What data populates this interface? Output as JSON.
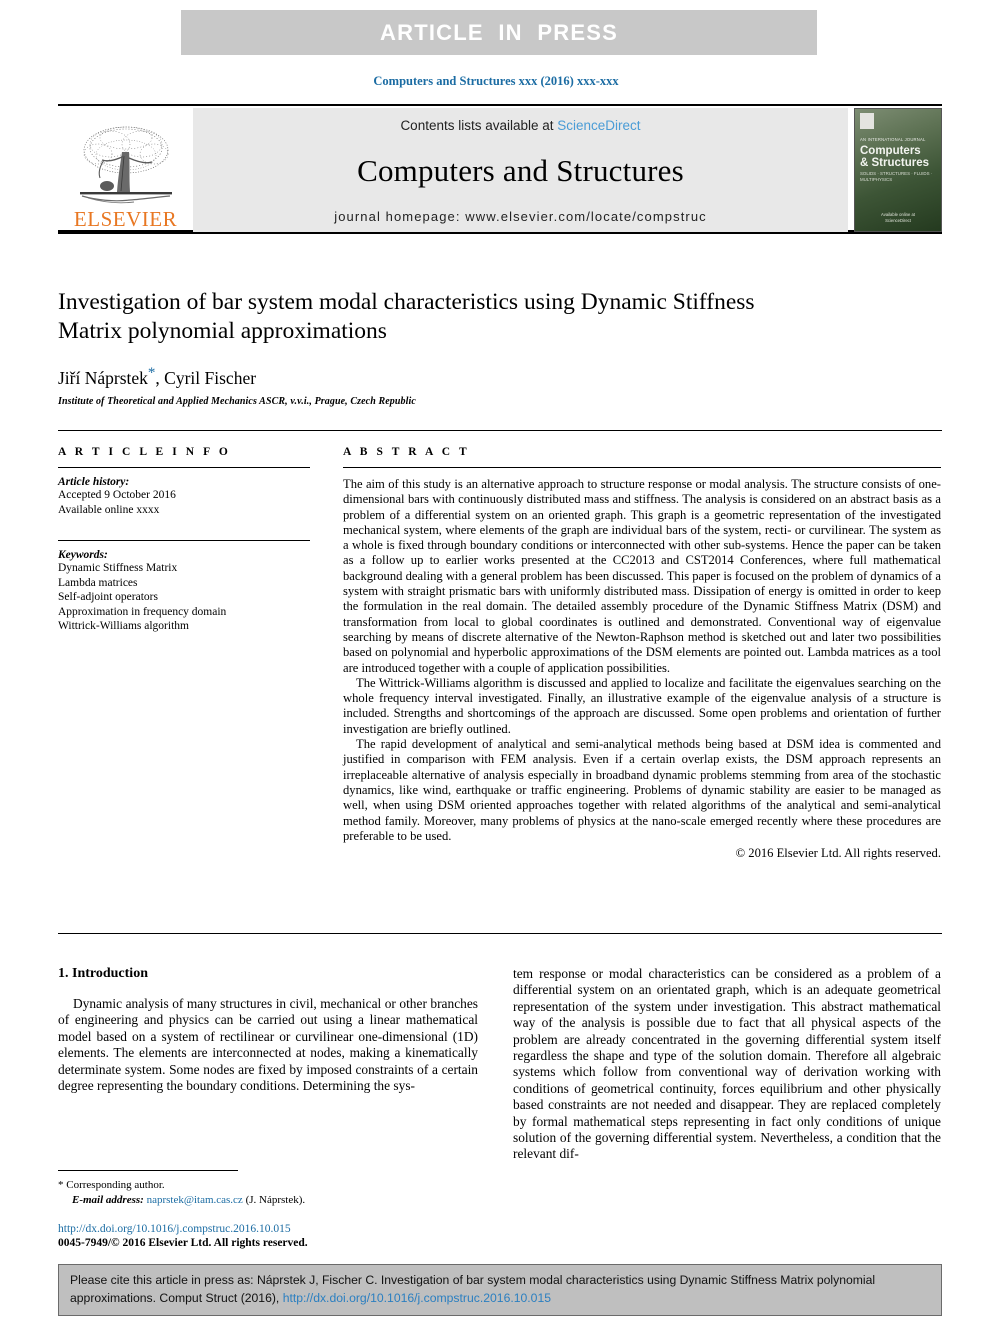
{
  "banner": {
    "text": "ARTICLE  IN  PRESS",
    "bg_color": "#C8C8C8",
    "text_color": "#FFFFFF"
  },
  "journal_ref": "Computers and Structures xxx (2016) xxx-xxx",
  "masthead": {
    "contents_prefix": "Contents lists available at ",
    "sciencedirect_link": "ScienceDirect",
    "journal_title": "Computers and Structures",
    "homepage": "journal homepage: www.elsevier.com/locate/compstruc",
    "publisher_wordmark": "ELSEVIER",
    "publisher_color": "#E87722",
    "link_color": "#4A9CD6",
    "panel_bg": "#E8E8E8",
    "cover": {
      "eyebrow": "AN INTERNATIONAL JOURNAL",
      "title_line1": "Computers",
      "title_line2": "& Structures",
      "subtitle": "SOLIDS · STRUCTURES · FLUIDS · MULTIPHYSICS",
      "footer_line1": "Available online at",
      "footer_line2": "ScienceDirect"
    }
  },
  "article": {
    "title": "Investigation of bar system modal characteristics using Dynamic Stiffness Matrix polynomial approximations",
    "authors": "Jiří Náprstek",
    "authors_rest": ", Cyril Fischer",
    "corresponding_marker": "*",
    "affiliation": "Institute of Theoretical and Applied Mechanics ASCR, v.v.i., Prague, Czech Republic"
  },
  "article_info": {
    "heading": "A R T I C L E    I N F O",
    "history_label": "Article history:",
    "history_lines": [
      "Accepted 9 October 2016",
      "Available online xxxx"
    ],
    "keywords_label": "Keywords:",
    "keywords": [
      "Dynamic Stiffness Matrix",
      "Lambda matrices",
      "Self-adjoint operators",
      "Approximation in frequency domain",
      "Wittrick-Williams algorithm"
    ]
  },
  "abstract": {
    "heading": "A B S T R A C T",
    "paragraphs": [
      "The aim of this study is an alternative approach to structure response or modal analysis. The structure consists of one-dimensional bars with continuously distributed mass and stiffness. The analysis is considered on an abstract basis as a problem of a differential system on an oriented graph. This graph is a geometric representation of the investigated mechanical system, where elements of the graph are individual bars of the system, recti- or curvilinear. The system as a whole is fixed through boundary conditions or interconnected with other sub-systems. Hence the paper can be taken as a follow up to earlier works presented at the CC2013 and CST2014 Conferences, where full mathematical background dealing with a general problem has been discussed. This paper is focused on the problem of dynamics of a system with straight prismatic bars with uniformly distributed mass. Dissipation of energy is omitted in order to keep the formulation in the real domain. The detailed assembly procedure of the Dynamic Stiffness Matrix (DSM) and transformation from local to global coordinates is outlined and demonstrated. Conventional way of eigenvalue searching by means of discrete alternative of the Newton-Raphson method is sketched out and later two possibilities based on polynomial and hyperbolic approximations of the DSM elements are pointed out. Lambda matrices as a tool are introduced together with a couple of application possibilities.",
      "The Wittrick-Williams algorithm is discussed and applied to localize and facilitate the eigenvalues searching on the whole frequency interval investigated. Finally, an illustrative example of the eigenvalue analysis of a structure is included. Strengths and shortcomings of the approach are discussed. Some open problems and orientation of further investigation are briefly outlined.",
      "The rapid development of analytical and semi-analytical methods being based at DSM idea is commented and justified in comparison with FEM analysis. Even if a certain overlap exists, the DSM approach represents an irreplaceable alternative of analysis especially in broadband dynamic problems stemming from area of the stochastic dynamics, like wind, earthquake or traffic engineering. Problems of dynamic stability are easier to be managed as well, when using DSM oriented approaches together with related algorithms of the analytical and semi-analytical method family. Moreover, many problems of physics at the nano-scale emerged recently where these procedures are preferable to be used."
    ],
    "copyright": "© 2016 Elsevier Ltd. All rights reserved."
  },
  "body": {
    "section_title": "1. Introduction",
    "left_paragraph": "Dynamic analysis of many structures in civil, mechanical or other branches of engineering and physics can be carried out using a linear mathematical model based on a system of rectilinear or curvilinear one-dimensional (1D) elements. The elements are interconnected at nodes, making a kinematically determinate system. Some nodes are fixed by imposed constraints of a certain degree representing the boundary conditions. Determining the sys-",
    "right_paragraph": "tem response or modal characteristics can be considered as a problem of a differential system on an orientated graph, which is an adequate geometrical representation of the system under investigation. This abstract mathematical way of the analysis is possible due to fact that all physical aspects of the problem are already concentrated in the governing differential system itself regardless the shape and type of the solution domain. Therefore all algebraic systems which follow from conventional way of derivation working with conditions of geometrical continuity, forces equilibrium and other physically based constraints are not needed and disappear. They are replaced completely by formal mathematical steps representing in fact only conditions of unique solution of the governing differential system. Nevertheless, a condition that the relevant dif-"
  },
  "footnote": {
    "marker": "*",
    "corresponding_author": "Corresponding author.",
    "email_label": "E-mail address:",
    "email": "naprstek@itam.cas.cz",
    "email_owner": "(J. Náprstek)."
  },
  "footer": {
    "doi_url": "http://dx.doi.org/10.1016/j.compstruc.2016.10.015",
    "issn_line": "0045-7949/© 2016 Elsevier Ltd. All rights reserved."
  },
  "cite_box": {
    "text_before": "Please cite this article in press as: Náprstek J, Fischer C. Investigation of bar system modal characteristics using Dynamic Stiffness Matrix polynomial approximations. Comput Struct (2016), ",
    "link": "http://dx.doi.org/10.1016/j.compstruc.2016.10.015",
    "bg_color": "#BFBFBF"
  }
}
